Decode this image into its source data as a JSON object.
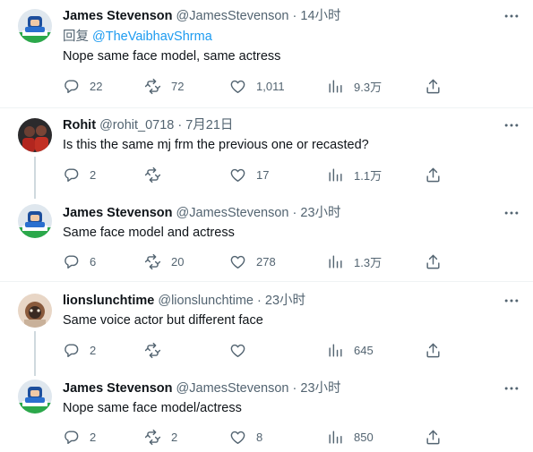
{
  "tweets": [
    {
      "author": "James Stevenson",
      "handle": "@JamesStevenson",
      "time": "14小时",
      "reply_prefix": "回复",
      "reply_to": "@TheVaibhavShrma",
      "text": "Nope same face model, same actress",
      "replies": "22",
      "retweets": "72",
      "likes": "1,011",
      "views": "9.3万"
    },
    {
      "author": "Rohit",
      "handle": "@rohit_0718",
      "time": "7月21日",
      "text": "Is this the same mj frm the previous one or recasted?",
      "replies": "2",
      "retweets": "",
      "likes": "17",
      "views": "1.1万"
    },
    {
      "author": "James Stevenson",
      "handle": "@JamesStevenson",
      "time": "23小时",
      "text": "Same face model and actress",
      "replies": "6",
      "retweets": "20",
      "likes": "278",
      "views": "1.3万"
    },
    {
      "author": "lionslunchtime",
      "handle": "@lionslunchtime",
      "time": "23小时",
      "text": "Same voice actor but different face",
      "replies": "2",
      "retweets": "",
      "likes": "",
      "views": "645"
    },
    {
      "author": "James Stevenson",
      "handle": "@JamesStevenson",
      "time": "23小时",
      "text": "Nope same face model/actress",
      "replies": "2",
      "retweets": "2",
      "likes": "8",
      "views": "850"
    }
  ],
  "separator": "·",
  "colors": {
    "text": "#0f1419",
    "secondary": "#536471",
    "link": "#1d9bf0",
    "divider": "#eff3f4",
    "thread_line": "#cfd9de"
  },
  "icons": {
    "more": "more-icon",
    "reply": "reply-icon",
    "retweet": "retweet-icon",
    "like": "heart-icon",
    "views": "views-icon",
    "share": "share-icon"
  }
}
